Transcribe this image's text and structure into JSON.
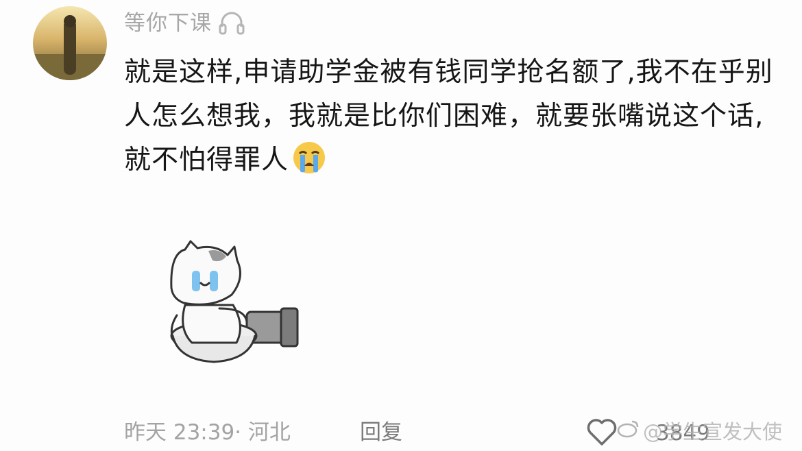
{
  "comment": {
    "username": "等你下课",
    "text": "就是这样,申请助学金被有钱同学抢名额了,我不在乎别人怎么想我，我就是比你们困难，就要张嘴说这个话,就不怕得罪人",
    "time_location": "昨天 23:39· 河北",
    "reply_label": "回复",
    "like_count": "3849"
  },
  "watermark": {
    "text": "@学生宣发大使"
  },
  "icons": {
    "badge": "headphone-icon",
    "emoji": "loudly-crying-face-emoji",
    "like": "heart-outline-icon",
    "watermark": "weibo-logo-icon"
  },
  "colors": {
    "background": "#fdfdfd",
    "username": "#a7a7a7",
    "meta": "#a3a3a3",
    "action": "#7a7a7a"
  }
}
